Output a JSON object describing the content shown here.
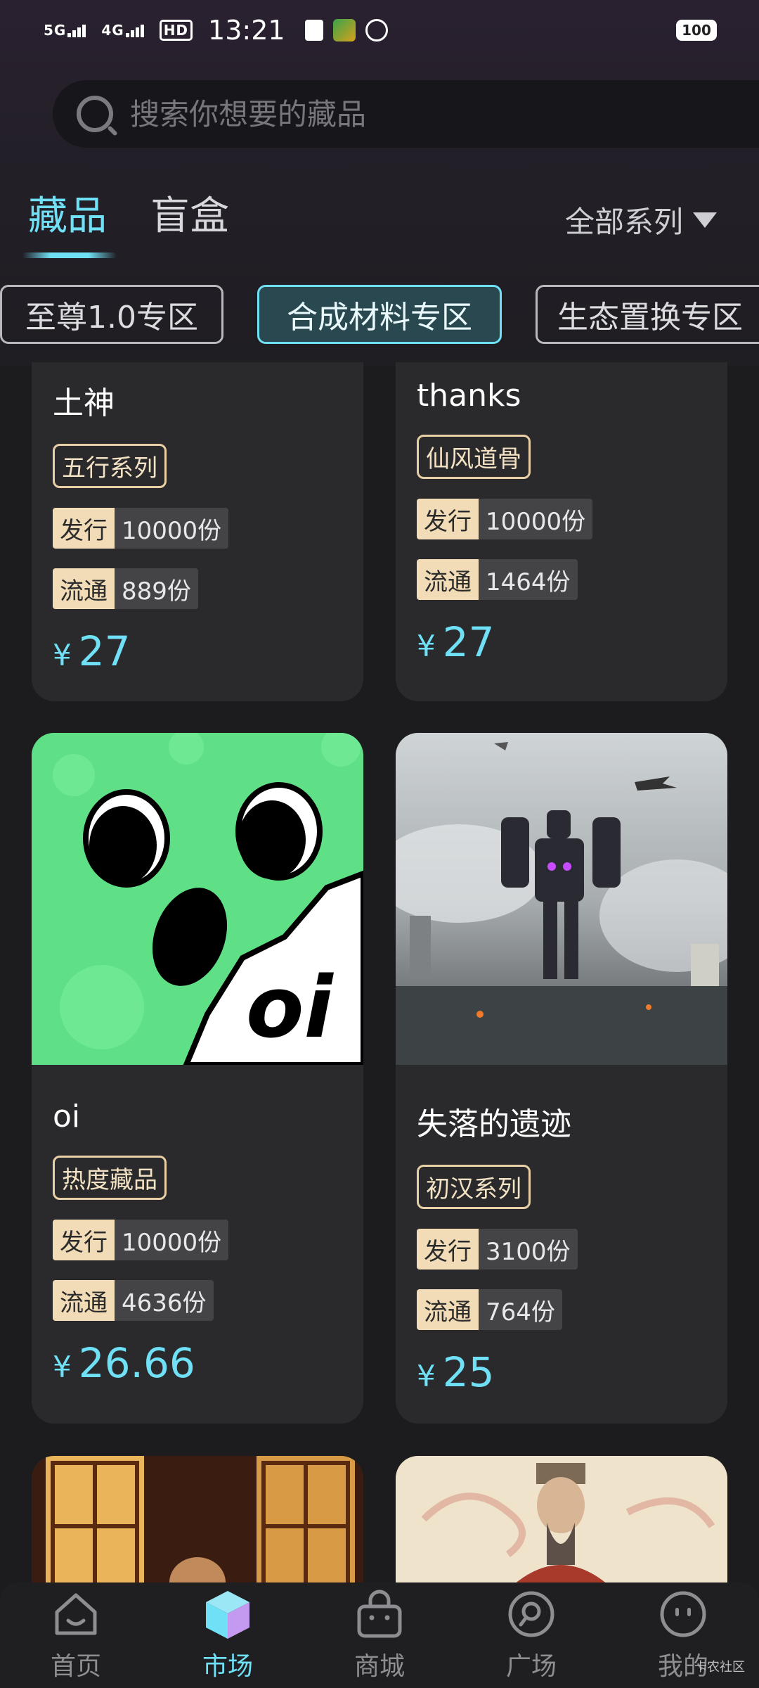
{
  "status_bar": {
    "network1": "5G",
    "network2": "4G",
    "hd": "HD",
    "time": "13:21",
    "battery": "100"
  },
  "search": {
    "placeholder": "搜索你想要的藏品"
  },
  "tabs": [
    {
      "label": "藏品",
      "active": true
    },
    {
      "label": "盲盒",
      "active": false
    }
  ],
  "series_filter": {
    "label": "全部系列"
  },
  "zones": [
    {
      "label": "至尊1.0专区",
      "active": false
    },
    {
      "label": "合成材料专区",
      "active": true
    },
    {
      "label": "生态置换专区",
      "active": false
    }
  ],
  "cards": [
    {
      "title": "土神",
      "series": "五行系列",
      "issue_label": "发行",
      "issue_value": "10000份",
      "circ_label": "流通",
      "circ_value": "889份",
      "currency": "¥",
      "price": "27"
    },
    {
      "title": "thanks",
      "series": "仙风道骨",
      "issue_label": "发行",
      "issue_value": "10000份",
      "circ_label": "流通",
      "circ_value": "1464份",
      "currency": "¥",
      "price": "27"
    },
    {
      "title": "oi",
      "series": "热度藏品",
      "issue_label": "发行",
      "issue_value": "10000份",
      "circ_label": "流通",
      "circ_value": "4636份",
      "currency": "¥",
      "price": "26.66",
      "image_text": "oi"
    },
    {
      "title": "失落的遗迹",
      "series": "初汉系列",
      "issue_label": "发行",
      "issue_value": "3100份",
      "circ_label": "流通",
      "circ_value": "764份",
      "currency": "¥",
      "price": "25"
    }
  ],
  "bottom_nav": [
    {
      "label": "首页",
      "icon": "home-icon",
      "active": false
    },
    {
      "label": "市场",
      "icon": "market-cube-icon",
      "active": true
    },
    {
      "label": "商城",
      "icon": "shop-bag-icon",
      "active": false
    },
    {
      "label": "广场",
      "icon": "chat-plaza-icon",
      "active": false
    },
    {
      "label": "我的",
      "icon": "profile-face-icon",
      "active": false
    }
  ],
  "watermark": "卡农社区",
  "colors": {
    "accent": "#6fe0f5",
    "tag": "#f1dcb7",
    "background": "#1c1c1e",
    "card": "#2a2a2c"
  }
}
